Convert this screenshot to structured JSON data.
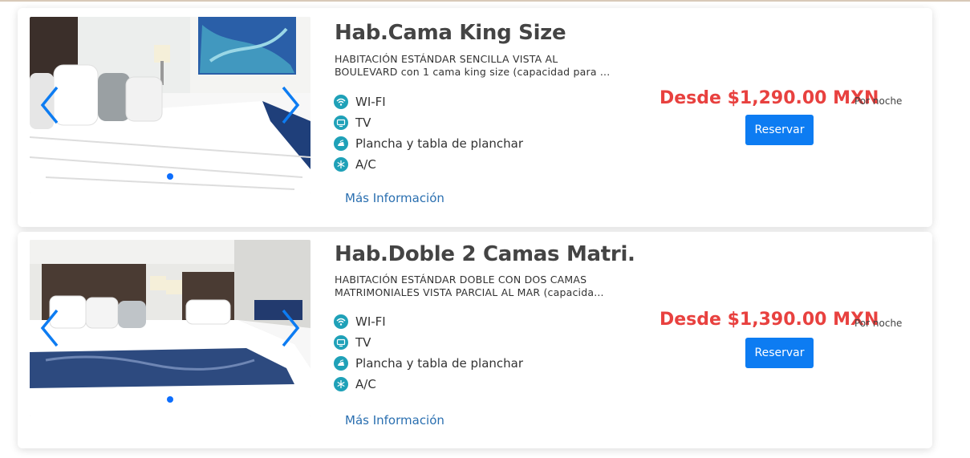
{
  "colors": {
    "price": "#e8413f",
    "button": "#0d7cf2",
    "icon": "#1fa1b8",
    "link": "#2a6fb0",
    "arrow": "#0d7cf2"
  },
  "rooms": [
    {
      "title": "Hab.Cama King Size",
      "description": "HABITACIÓN ESTÁNDAR SENCILLA VISTA AL BOULEVARD con 1 cama king size (capacidad para ...",
      "amenities": [
        {
          "icon": "wifi-icon",
          "label": "WI-FI"
        },
        {
          "icon": "tv-icon",
          "label": "TV"
        },
        {
          "icon": "iron-icon",
          "label": "Plancha y tabla de planchar"
        },
        {
          "icon": "snowflake-icon",
          "label": "A/C"
        }
      ],
      "more_info": "Más Información",
      "price": "Desde $1,290.00 MXN",
      "per_night": "Por noche",
      "book_label": "Reservar"
    },
    {
      "title": "Hab.Doble 2 Camas Matri.",
      "description": "HABITACIÓN ESTÁNDAR DOBLE CON DOS CAMAS MATRIMONIALES VISTA PARCIAL AL MAR (capacida...",
      "amenities": [
        {
          "icon": "wifi-icon",
          "label": "WI-FI"
        },
        {
          "icon": "tv-icon",
          "label": "TV"
        },
        {
          "icon": "iron-icon",
          "label": "Plancha y tabla de planchar"
        },
        {
          "icon": "snowflake-icon",
          "label": "A/C"
        }
      ],
      "more_info": "Más Información",
      "price": "Desde $1,390.00 MXN",
      "per_night": "Por noche",
      "book_label": "Reservar"
    }
  ]
}
